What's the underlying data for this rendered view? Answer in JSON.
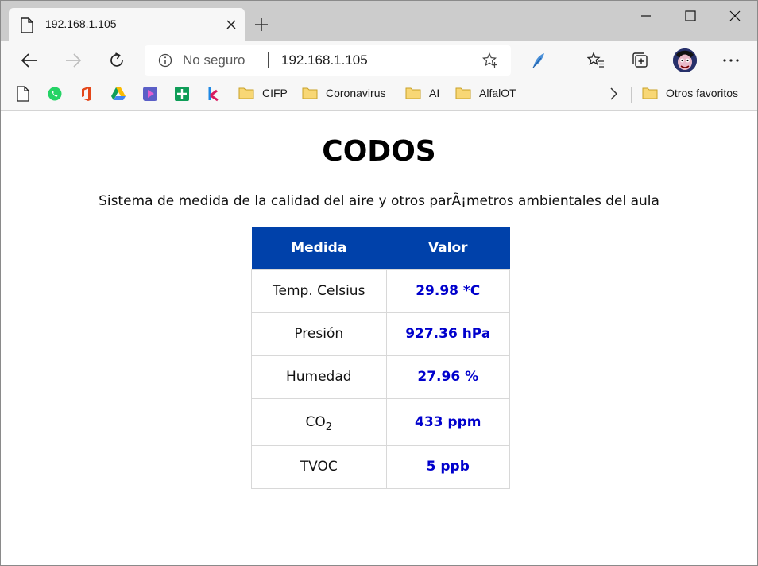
{
  "browser": {
    "tab_title": "192.168.1.105",
    "not_secure_label": "No seguro",
    "url": "192.168.1.105",
    "bookmark_folders": [
      "CIFP",
      "Coronavirus",
      "AI",
      "AlfalOT"
    ],
    "other_favorites_label": "Otros favoritos"
  },
  "icons": {
    "tab": "page-icon",
    "bookmarks": [
      "page-icon",
      "whatsapp-icon",
      "office-icon",
      "google-drive-icon",
      "media-app-icon",
      "google-sheets-icon",
      "app-k-icon"
    ]
  },
  "page": {
    "title": "CODOS",
    "subtitle": "Sistema de medida de la calidad del aire y otros parÃ¡metros ambientales del aula"
  },
  "table": {
    "headers": [
      "Medida",
      "Valor"
    ],
    "rows": [
      {
        "measure": "Temp. Celsius",
        "value": "29.98 *C"
      },
      {
        "measure": "Presión",
        "value": "927.36 hPa"
      },
      {
        "measure": "Humedad",
        "value": "27.96 %"
      },
      {
        "measure": "CO",
        "measure_sub": "2",
        "value": "433 ppm"
      },
      {
        "measure": "TVOC",
        "value": "5 ppb"
      }
    ]
  },
  "colors": {
    "header_bg": "#0041aa",
    "value_text": "#0000cc",
    "chrome_bg": "#cccccc",
    "toolbar_bg": "#f7f7f7"
  }
}
